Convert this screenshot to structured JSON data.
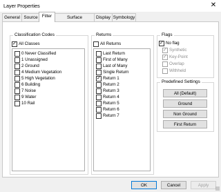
{
  "window": {
    "title": "Layer Properties",
    "close_glyph": "✕"
  },
  "tabs": [
    {
      "label": "General",
      "active": false
    },
    {
      "label": "Source",
      "active": false
    },
    {
      "label": "Filter",
      "active": true
    },
    {
      "label": "Surface Constraints",
      "active": false
    },
    {
      "label": "Display",
      "active": false
    },
    {
      "label": "Symbology",
      "active": false
    }
  ],
  "classification": {
    "title": "Classification Codes",
    "all_label": "All Classes",
    "all_checked": true,
    "items": [
      {
        "label": "0  Never Classified",
        "checked": false
      },
      {
        "label": "1  Unassigned",
        "checked": false
      },
      {
        "label": "2  Ground",
        "checked": false
      },
      {
        "label": "4  Medium Vegetation",
        "checked": false
      },
      {
        "label": "5  High Vegetation",
        "checked": false
      },
      {
        "label": "6  Building",
        "checked": false
      },
      {
        "label": "7  Noise",
        "checked": false
      },
      {
        "label": "9  Water",
        "checked": false
      },
      {
        "label": "10  Rail",
        "checked": false
      }
    ]
  },
  "returns": {
    "title": "Returns",
    "all_label": "All Returns",
    "all_checked": false,
    "items": [
      {
        "label": "Last Return",
        "checked": false
      },
      {
        "label": "First of Many",
        "checked": false
      },
      {
        "label": "Last of Many",
        "checked": false
      },
      {
        "label": "Single Return",
        "checked": false
      },
      {
        "label": "Return 1",
        "checked": true
      },
      {
        "label": "Return 2",
        "checked": false
      },
      {
        "label": "Return 3",
        "checked": false
      },
      {
        "label": "Return 4",
        "checked": false
      },
      {
        "label": "Return 5",
        "checked": false
      },
      {
        "label": "Return 6",
        "checked": false
      },
      {
        "label": "Return 7",
        "checked": false
      }
    ]
  },
  "flags": {
    "title": "Flags",
    "items": [
      {
        "label": "No flag",
        "checked": true,
        "enabled": true
      },
      {
        "label": "Synthetic",
        "checked": true,
        "enabled": false
      },
      {
        "label": "Key-Point",
        "checked": true,
        "enabled": false
      },
      {
        "label": "Overlap",
        "checked": false,
        "enabled": false
      },
      {
        "label": "Withheld",
        "checked": false,
        "enabled": false
      }
    ]
  },
  "predefined": {
    "title": "Predefined Settings",
    "buttons": [
      "All (Default)",
      "Ground",
      "Non Ground",
      "First Return"
    ]
  },
  "footer": {
    "ok": "OK",
    "cancel": "Cancel",
    "apply": "Apply"
  }
}
